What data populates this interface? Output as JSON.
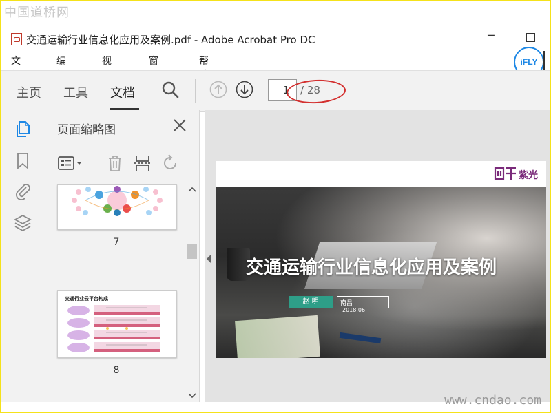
{
  "watermarks": {
    "top": "中国道桥网",
    "bottom": "www.cndao.com"
  },
  "window": {
    "title": "交通运输行业信息化应用及案例.pdf - Adobe Acrobat Pro DC"
  },
  "menu": [
    "文件(F)",
    "编辑(E)",
    "视图(V)",
    "窗口(W)",
    "帮助(H)"
  ],
  "ifly": {
    "label": "iFLY"
  },
  "toolbar": {
    "tabs": [
      {
        "label": "主页",
        "active": false
      },
      {
        "label": "工具",
        "active": false
      },
      {
        "label": "文档",
        "active": true
      }
    ],
    "page_current": "1",
    "page_total": "/ 28"
  },
  "panel": {
    "title": "页面缩略图",
    "thumbnails": [
      {
        "number": "7"
      },
      {
        "number": "8",
        "heading": "交通行业云平台构成"
      },
      {
        "number": "…"
      }
    ]
  },
  "document": {
    "logo_text": "紫光",
    "hero_title": "交通运输行业信息化应用及案例",
    "author": "赵  明",
    "org": "南昌",
    "date": "2018.06"
  },
  "colors": {
    "accent_blue": "#1e88e5",
    "highlight_red": "#d3302f",
    "tag_green": "#2e9e88",
    "frame_yellow": "#f5e21a"
  }
}
